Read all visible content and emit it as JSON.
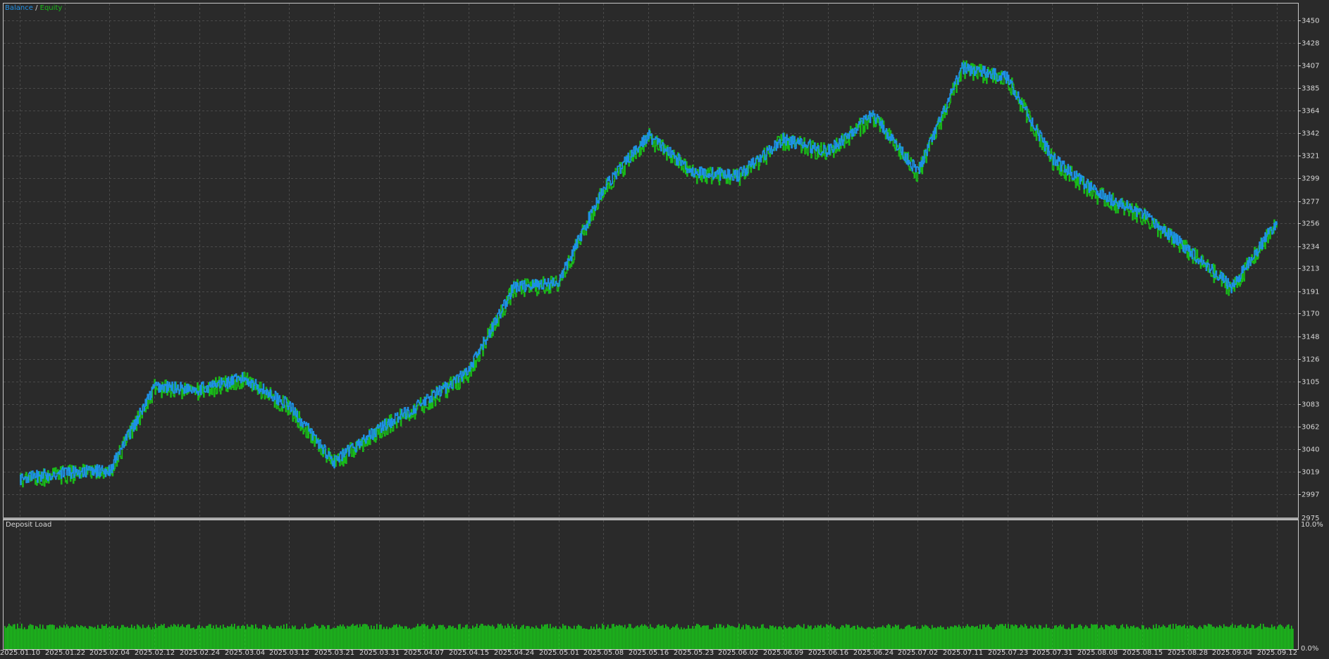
{
  "legend": {
    "balance_label": "Balance",
    "separator": "/",
    "equity_label": "Equity"
  },
  "deposit_panel": {
    "title": "Deposit Load",
    "ylim_labels": [
      "10.0%",
      "0.0%"
    ],
    "load_bar_level": 0.18
  },
  "colors": {
    "background": "#2a2a2a",
    "grid": "#4a4a4a",
    "frame": "#c8c8c8",
    "balance": "#1e90e6",
    "equity": "#19b919",
    "deposit_load": "#19c819",
    "text": "#d8d8d8"
  },
  "chart_data": [
    {
      "type": "line",
      "title": "",
      "xlabel": "",
      "ylabel": "",
      "ylim": [
        2975,
        3466
      ],
      "y_ticks": [
        "2997",
        "3019",
        "3040",
        "3062",
        "3083",
        "3105",
        "3126",
        "3148",
        "3170",
        "3191",
        "3213",
        "3234",
        "3256",
        "3277",
        "3299",
        "3321",
        "3342",
        "3364",
        "3385",
        "3407",
        "3428",
        "3450"
      ],
      "y_axis_bottom_label": "2975",
      "x_ticks": [
        "2025.01.10",
        "2025.01.22",
        "2025.02.04",
        "2025.02.12",
        "2025.02.24",
        "2025.03.04",
        "2025.03.12",
        "2025.03.21",
        "2025.03.31",
        "2025.04.07",
        "2025.04.15",
        "2025.04.24",
        "2025.05.01",
        "2025.05.08",
        "2025.05.16",
        "2025.05.23",
        "2025.06.02",
        "2025.06.09",
        "2025.06.16",
        "2025.06.24",
        "2025.07.02",
        "2025.07.11",
        "2025.07.23",
        "2025.07.31",
        "2025.08.08",
        "2025.08.15",
        "2025.08.28",
        "2025.09.04",
        "2025.09.12"
      ],
      "grid": true,
      "legend_position": "top-left",
      "series": [
        {
          "name": "Balance",
          "x": [
            "2025.01.10",
            "2025.01.22",
            "2025.02.04",
            "2025.02.12",
            "2025.02.24",
            "2025.03.04",
            "2025.03.12",
            "2025.03.21",
            "2025.03.31",
            "2025.04.07",
            "2025.04.15",
            "2025.04.24",
            "2025.05.01",
            "2025.05.08",
            "2025.05.16",
            "2025.05.23",
            "2025.06.02",
            "2025.06.09",
            "2025.06.16",
            "2025.06.24",
            "2025.07.02",
            "2025.07.11",
            "2025.07.23",
            "2025.07.31",
            "2025.08.08",
            "2025.08.15",
            "2025.08.28",
            "2025.09.04",
            "2025.09.12"
          ],
          "values": [
            3012,
            3018,
            3020,
            3100,
            3098,
            3108,
            3082,
            3028,
            3060,
            3085,
            3115,
            3195,
            3200,
            3290,
            3340,
            3305,
            3302,
            3336,
            3325,
            3360,
            3305,
            3405,
            3395,
            3318,
            3285,
            3265,
            3232,
            3195,
            3258
          ]
        },
        {
          "name": "Equity",
          "x": [
            "2025.01.10",
            "2025.01.22",
            "2025.02.04",
            "2025.02.12",
            "2025.02.24",
            "2025.03.04",
            "2025.03.12",
            "2025.03.21",
            "2025.03.31",
            "2025.04.07",
            "2025.04.15",
            "2025.04.24",
            "2025.05.01",
            "2025.05.08",
            "2025.05.16",
            "2025.05.23",
            "2025.06.02",
            "2025.06.09",
            "2025.06.16",
            "2025.06.24",
            "2025.07.02",
            "2025.07.11",
            "2025.07.23",
            "2025.07.31",
            "2025.08.08",
            "2025.08.15",
            "2025.08.28",
            "2025.09.04",
            "2025.09.12"
          ],
          "values": [
            3010,
            3016,
            3018,
            3098,
            3096,
            3106,
            3080,
            3026,
            3058,
            3083,
            3113,
            3193,
            3198,
            3288,
            3338,
            3303,
            3300,
            3334,
            3323,
            3358,
            3303,
            3403,
            3393,
            3316,
            3283,
            3263,
            3230,
            3193,
            3256
          ]
        }
      ]
    },
    {
      "type": "bar",
      "title": "Deposit Load",
      "ylim": [
        0,
        10
      ],
      "y_ticks": [
        "10.0%",
        "0.0%"
      ],
      "typical_value_percent": 1.8
    }
  ]
}
